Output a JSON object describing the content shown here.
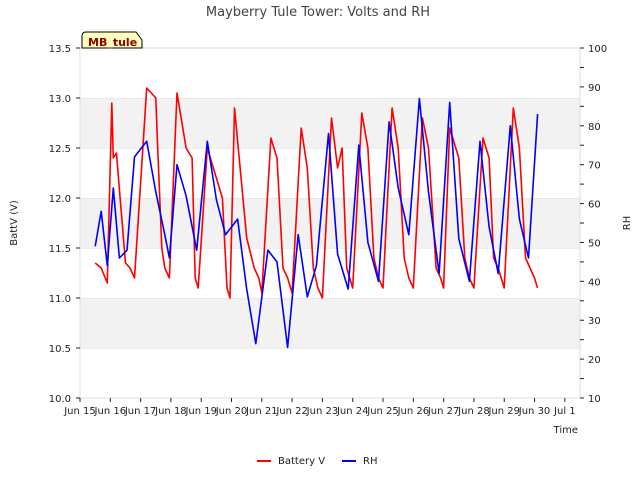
{
  "chart_data": {
    "type": "line",
    "title": "Mayberry Tule Tower: Volts and RH",
    "station_label": "MB_tule",
    "xlabel": "Time",
    "ylabel_left": "BattV (V)",
    "ylabel_right": "RH",
    "xlim": [
      15,
      31.5
    ],
    "ylim_left": [
      10.0,
      13.5
    ],
    "ylim_right": [
      10,
      100
    ],
    "x_ticks": [
      {
        "x": 15,
        "label": "Jun 15"
      },
      {
        "x": 16,
        "label": "Jun 16"
      },
      {
        "x": 17,
        "label": "Jun 17"
      },
      {
        "x": 18,
        "label": "Jun 18"
      },
      {
        "x": 19,
        "label": "Jun 19"
      },
      {
        "x": 20,
        "label": "Jun 20"
      },
      {
        "x": 21,
        "label": "Jun 21"
      },
      {
        "x": 22,
        "label": "Jun 22"
      },
      {
        "x": 23,
        "label": "Jun 23"
      },
      {
        "x": 24,
        "label": "Jun 24"
      },
      {
        "x": 25,
        "label": "Jun 25"
      },
      {
        "x": 26,
        "label": "Jun 26"
      },
      {
        "x": 27,
        "label": "Jun 27"
      },
      {
        "x": 28,
        "label": "Jun 28"
      },
      {
        "x": 29,
        "label": "Jun 29"
      },
      {
        "x": 30,
        "label": "Jun 30"
      },
      {
        "x": 31,
        "label": "Jul 1"
      }
    ],
    "y_ticks_left": [
      "10.0",
      "10.5",
      "11.0",
      "11.5",
      "12.0",
      "12.5",
      "13.0",
      "13.5"
    ],
    "y_ticks_right": [
      "10",
      "20",
      "30",
      "40",
      "50",
      "60",
      "70",
      "80",
      "90",
      "100"
    ],
    "grid": "horizontal bands",
    "legend_position": "bottom-center",
    "series": [
      {
        "name": "Battery V",
        "axis": "left",
        "color": "#ff0000",
        "x": [
          15.5,
          15.7,
          15.9,
          16.05,
          16.1,
          16.2,
          16.5,
          16.65,
          16.8,
          17.2,
          17.5,
          17.55,
          17.7,
          17.8,
          17.95,
          18.2,
          18.5,
          18.7,
          18.8,
          18.9,
          19.2,
          19.5,
          19.7,
          19.85,
          19.95,
          20.1,
          20.5,
          20.75,
          20.9,
          21.0,
          21.3,
          21.5,
          21.7,
          21.85,
          22.0,
          22.3,
          22.5,
          22.7,
          22.85,
          23.0,
          23.3,
          23.5,
          23.65,
          23.8,
          24.0,
          24.3,
          24.5,
          24.7,
          24.85,
          25.0,
          25.3,
          25.5,
          25.7,
          25.85,
          26.0,
          26.3,
          26.5,
          26.75,
          26.9,
          27.0,
          27.2,
          27.5,
          27.7,
          27.85,
          28.0,
          28.3,
          28.5,
          28.65,
          28.8,
          29.0,
          29.3,
          29.5,
          29.7,
          29.85,
          30.0,
          30.1
        ],
        "y": [
          11.35,
          11.3,
          11.15,
          12.95,
          12.4,
          12.45,
          11.35,
          11.3,
          11.2,
          13.1,
          13.0,
          12.6,
          11.5,
          11.3,
          11.2,
          13.05,
          12.5,
          12.4,
          11.2,
          11.1,
          12.5,
          12.2,
          12.0,
          11.1,
          11.0,
          12.9,
          11.6,
          11.3,
          11.2,
          11.05,
          12.6,
          12.4,
          11.3,
          11.2,
          11.05,
          12.7,
          12.3,
          11.3,
          11.1,
          11.0,
          12.8,
          12.3,
          12.5,
          11.3,
          11.1,
          12.85,
          12.5,
          11.4,
          11.2,
          11.1,
          12.9,
          12.5,
          11.4,
          11.2,
          11.1,
          12.8,
          12.5,
          11.3,
          11.2,
          11.1,
          12.7,
          12.4,
          11.4,
          11.2,
          11.1,
          12.6,
          12.4,
          11.4,
          11.3,
          11.1,
          12.9,
          12.5,
          11.4,
          11.3,
          11.2,
          11.1
        ]
      },
      {
        "name": "RH",
        "axis": "right",
        "color": "#0000ff",
        "x": [
          15.5,
          15.7,
          15.9,
          16.1,
          16.3,
          16.55,
          16.8,
          17.2,
          17.5,
          17.8,
          17.95,
          18.2,
          18.5,
          18.85,
          19.2,
          19.5,
          19.8,
          20.2,
          20.5,
          20.8,
          21.2,
          21.5,
          21.85,
          22.2,
          22.5,
          22.8,
          23.2,
          23.5,
          23.85,
          24.2,
          24.5,
          24.85,
          25.2,
          25.5,
          25.85,
          26.2,
          26.5,
          26.85,
          27.2,
          27.5,
          27.85,
          28.2,
          28.5,
          28.8,
          29.2,
          29.5,
          29.8,
          30.1
        ],
        "y": [
          49,
          58,
          44,
          64,
          46,
          48,
          72,
          76,
          63,
          52,
          46,
          70,
          62,
          48,
          76,
          61,
          52,
          56,
          38,
          24,
          48,
          45,
          23,
          52,
          36,
          44,
          78,
          47,
          38,
          75,
          50,
          40,
          81,
          64,
          52,
          87,
          63,
          42,
          86,
          51,
          40,
          76,
          54,
          42,
          80,
          56,
          46,
          83
        ]
      }
    ]
  }
}
